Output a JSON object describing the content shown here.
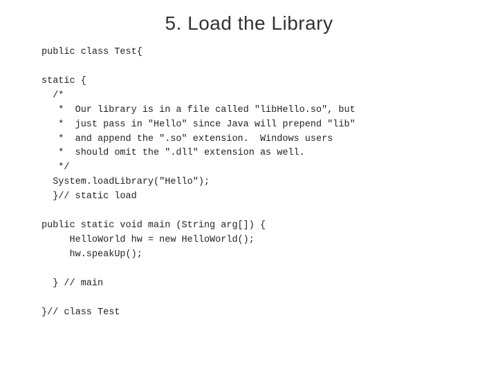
{
  "header": {
    "title": "5.  Load the Library"
  },
  "code": {
    "lines": [
      "public class Test{",
      "",
      "static {",
      "  /*",
      "   *  Our library is in a file called \"libHello.so\", but",
      "   *  just pass in \"Hello\" since Java will prepend \"lib\"",
      "   *  and append the \".so\" extension.  Windows users",
      "   *  should omit the \".dll\" extension as well.",
      "   */",
      "  System.loadLibrary(\"Hello\");",
      "  }// static load",
      "",
      "public static void main (String arg[]) {",
      "     HelloWorld hw = new HelloWorld();",
      "     hw.speakUp();",
      "",
      "  } // main",
      "",
      "}// class Test"
    ]
  }
}
